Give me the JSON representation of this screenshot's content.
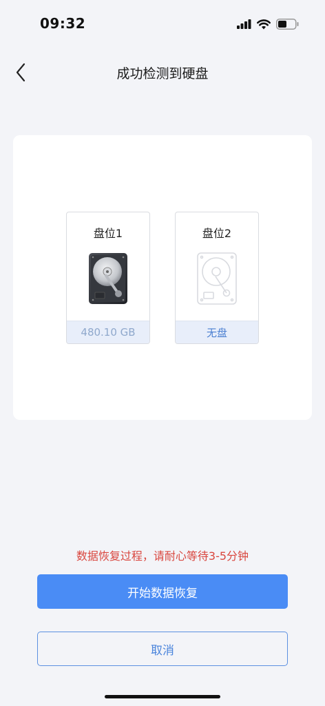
{
  "status_bar": {
    "time": "09:32",
    "icons": [
      "signal-icon",
      "wifi-icon",
      "battery-icon"
    ]
  },
  "nav": {
    "back_icon": "chevron-left-icon",
    "title": "成功检测到硬盘"
  },
  "slots": [
    {
      "label": "盘位1",
      "footer": "480.10 GB",
      "icon": "hard-drive-icon",
      "has_disk": true
    },
    {
      "label": "盘位2",
      "footer": "无盘",
      "icon": "hard-drive-outline-icon",
      "has_disk": false
    }
  ],
  "hint": "数据恢复过程，请耐心等待3-5分钟",
  "actions": {
    "start_label": "开始数据恢复",
    "cancel_label": "取消"
  },
  "colors": {
    "primary": "#4a8cf5",
    "warning": "#d9463e",
    "background": "#f3f4f8"
  }
}
